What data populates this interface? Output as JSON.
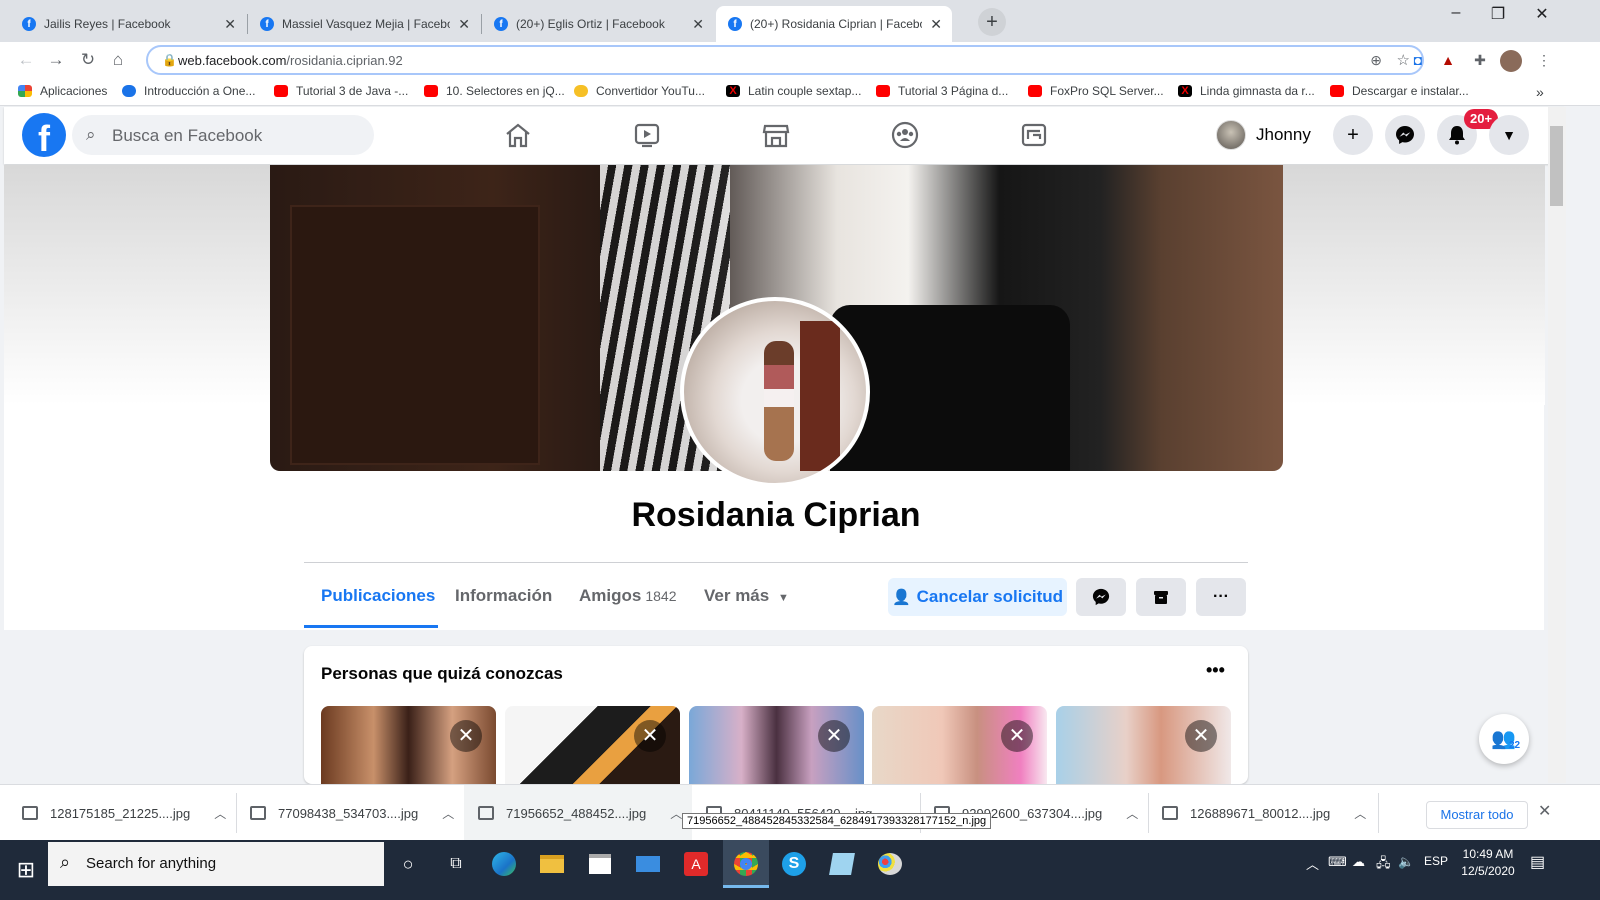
{
  "browser": {
    "tabs": [
      {
        "label": "Jailis Reyes | Facebook",
        "active": false
      },
      {
        "label": "Massiel Vasquez Mejia | Faceboo",
        "active": false
      },
      {
        "label": "(20+) Eglis Ortiz | Facebook",
        "active": false
      },
      {
        "label": "(20+) Rosidania Ciprian | Faceboo",
        "active": true
      }
    ],
    "url_host": "web.facebook.com",
    "url_path": "/rosidania.ciprian.92",
    "bookmarks": [
      {
        "label": "Aplicaciones",
        "icon": "apps"
      },
      {
        "label": "Introducción a One...",
        "icon": "cloud"
      },
      {
        "label": "Tutorial 3 de Java -...",
        "icon": "yt"
      },
      {
        "label": "10. Selectores en jQ...",
        "icon": "yt"
      },
      {
        "label": "Convertidor YouTu...",
        "icon": "yel"
      },
      {
        "label": "Latin couple sextap...",
        "icon": "x"
      },
      {
        "label": "Tutorial 3 Página d...",
        "icon": "yt"
      },
      {
        "label": "FoxPro SQL Server...",
        "icon": "yt"
      },
      {
        "label": "Linda gimnasta da r...",
        "icon": "x"
      },
      {
        "label": "Descargar e instalar...",
        "icon": "yt"
      }
    ],
    "bookmarks_more": "»"
  },
  "facebook": {
    "search_placeholder": "Busca en Facebook",
    "user_name": "Jhonny",
    "notif_badge": "20+",
    "profile": {
      "name": "Rosidania Ciprian",
      "tabs": {
        "publicaciones": "Publicaciones",
        "informacion": "Información",
        "amigos": "Amigos",
        "amigos_count": "1842",
        "ver_mas": "Ver más"
      },
      "cancel_request": "Cancelar solicitud"
    },
    "pymk": {
      "title": "Personas que quizá conozcas",
      "more": "•••"
    },
    "friends_fab_count": "22"
  },
  "downloads": {
    "items": [
      "128175185_21225....jpg",
      "77098438_534703....jpg",
      "71956652_488452....jpg",
      "80411149_556430....jpg",
      "92992600_637304....jpg",
      "126889671_80012....jpg"
    ],
    "show_all": "Mostrar todo",
    "tooltip": "71956652_488452845332584_6284917393328177152_n.jpg"
  },
  "taskbar": {
    "search_placeholder": "Search for anything",
    "lang": "ESP",
    "time": "10:49 AM",
    "date": "12/5/2020"
  }
}
